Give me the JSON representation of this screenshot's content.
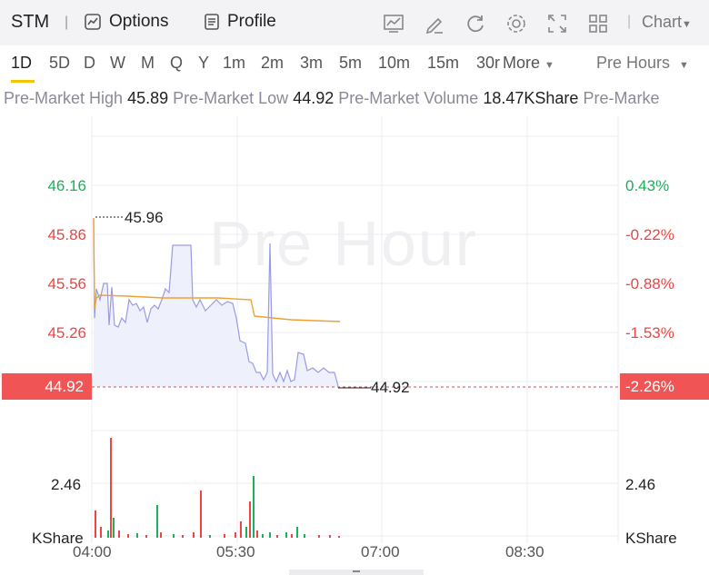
{
  "header": {
    "symbol": "STM",
    "separator": "|",
    "options_label": "Options",
    "profile_label": "Profile",
    "chart_dropdown": "Chart"
  },
  "timeframes": [
    "1D",
    "5D",
    "D",
    "W",
    "M",
    "Q",
    "Y",
    "1m",
    "2m",
    "3m",
    "5m",
    "10m",
    "15m",
    "30r",
    "More"
  ],
  "active_timeframe": "1D",
  "session_dropdown": "Pre Hours",
  "stats": {
    "high_label": "Pre-Market High",
    "high_value": "45.89",
    "low_label": "Pre-Market Low",
    "low_value": "44.92",
    "volume_label": "Pre-Market Volume",
    "volume_value": "18.47KShare",
    "extra_label": "Pre-Marke"
  },
  "chart": {
    "watermark": "Pre Hour",
    "left_ticks": [
      "46.16",
      "45.86",
      "45.56",
      "45.26"
    ],
    "right_ticks": [
      "0.43%",
      "-0.22%",
      "-0.88%",
      "-1.53%"
    ],
    "current_price": "44.92",
    "current_pct": "-2.26%",
    "high_callout": "45.96",
    "low_callout": "44.92",
    "volume_tick": "2.46",
    "volume_unit": "KShare",
    "time_labels": [
      "04:00",
      "05:30",
      "07:00",
      "08:30"
    ]
  },
  "colors": {
    "up": "#1ab05c",
    "down": "#ee4444",
    "price_line": "#9a9ae6",
    "avg_line": "#f0a030",
    "accent": "#f5c400"
  },
  "icons": [
    "options-icon",
    "profile-icon",
    "indicator-icon",
    "draw-icon",
    "refresh-icon",
    "settings-icon",
    "fullscreen-icon",
    "layout-icon"
  ]
}
